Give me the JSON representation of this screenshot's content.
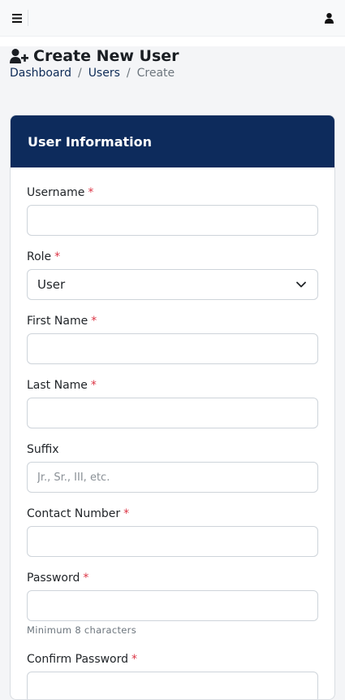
{
  "topbar": {
    "menu_icon": "hamburger-menu-icon",
    "user_icon": "user-icon"
  },
  "page": {
    "title": "Create New User",
    "title_icon": "user-plus-icon"
  },
  "breadcrumb": {
    "items": [
      "Dashboard",
      "Users"
    ],
    "separator": "/",
    "active": "Create"
  },
  "card": {
    "title": "User Information"
  },
  "form": {
    "username": {
      "label": "Username",
      "required_mark": "*",
      "value": ""
    },
    "role": {
      "label": "Role",
      "required_mark": "*",
      "selected": "User"
    },
    "first_name": {
      "label": "First Name",
      "required_mark": "*",
      "value": ""
    },
    "last_name": {
      "label": "Last Name",
      "required_mark": "*",
      "value": ""
    },
    "suffix": {
      "label": "Suffix",
      "placeholder": "Jr., Sr., III, etc.",
      "value": ""
    },
    "contact_number": {
      "label": "Contact Number",
      "required_mark": "*",
      "value": ""
    },
    "password": {
      "label": "Password",
      "required_mark": "*",
      "value": "",
      "help": "Minimum 8 characters"
    },
    "confirm_password": {
      "label": "Confirm Password",
      "required_mark": "*",
      "value": ""
    }
  },
  "colors": {
    "primary": "#0d2b5c",
    "required": "#dc3545",
    "link": "#0d2b57"
  }
}
